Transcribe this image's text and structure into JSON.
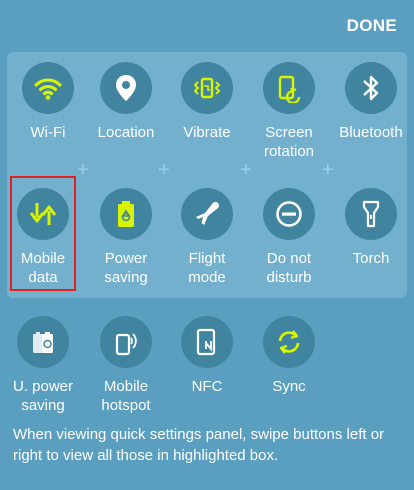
{
  "header": {
    "done_label": "DONE"
  },
  "highlighted_tiles": [
    {
      "label": "Wi-Fi",
      "icon": "wifi-icon",
      "active": true
    },
    {
      "label": "Location",
      "icon": "location-pin-icon",
      "active": false
    },
    {
      "label": "Vibrate",
      "icon": "vibrate-icon",
      "active": true
    },
    {
      "label": "Screen\nrotation",
      "icon": "screen-rotation-icon",
      "active": true
    },
    {
      "label": "Bluetooth",
      "icon": "bluetooth-icon",
      "active": false
    },
    {
      "label": "Mobile\ndata",
      "icon": "mobile-data-icon",
      "active": true
    },
    {
      "label": "Power\nsaving",
      "icon": "battery-recycle-icon",
      "active": true
    },
    {
      "label": "Flight\nmode",
      "icon": "airplane-icon",
      "active": false
    },
    {
      "label": "Do not\ndisturb",
      "icon": "do-not-disturb-icon",
      "active": false
    },
    {
      "label": "Torch",
      "icon": "flashlight-icon",
      "active": false
    }
  ],
  "other_tiles": [
    {
      "label": "U. power\nsaving",
      "icon": "ultra-power-saving-icon",
      "active": false
    },
    {
      "label": "Mobile\nhotspot",
      "icon": "hotspot-icon",
      "active": false
    },
    {
      "label": "NFC",
      "icon": "nfc-icon",
      "active": false
    },
    {
      "label": "Sync",
      "icon": "sync-icon",
      "active": true
    }
  ],
  "hint": "When viewing quick settings panel, swipe buttons left or right to view all those in highlighted box.",
  "colors": {
    "background": "#5a9fbf",
    "highlight_box": "#72b0cd",
    "circle": "#41849f",
    "active_icon": "#d8f400",
    "inactive_icon": "#ffffff",
    "selection_frame": "#e02020"
  }
}
